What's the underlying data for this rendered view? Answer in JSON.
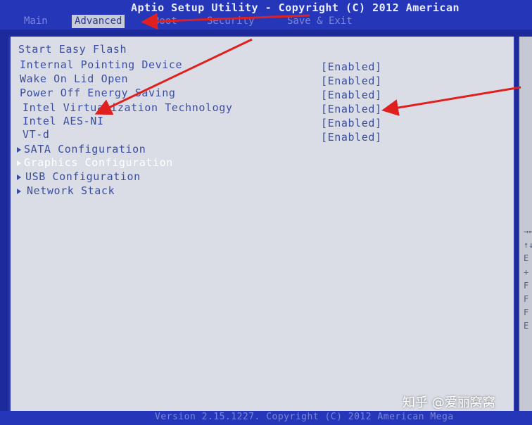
{
  "title": "Aptio Setup Utility - Copyright (C) 2012 American",
  "tabs": [
    {
      "label": "Main"
    },
    {
      "label": "Advanced"
    },
    {
      "label": "Boot"
    },
    {
      "label": "Security"
    },
    {
      "label": "Save & Exit"
    }
  ],
  "items": [
    {
      "label": "Start Easy Flash",
      "value": ""
    },
    {
      "label": "Internal Pointing Device",
      "value": "[Enabled]"
    },
    {
      "label": "Wake On Lid Open",
      "value": "[Enabled]"
    },
    {
      "label": "Power Off Energy Saving",
      "value": "[Enabled]"
    },
    {
      "label": "Intel Virtualization Technology",
      "value": "[Enabled]"
    },
    {
      "label": "Intel AES-NI",
      "value": "[Enabled]"
    },
    {
      "label": "VT-d",
      "value": "[Enabled]"
    }
  ],
  "submenus": [
    {
      "label": "SATA Configuration"
    },
    {
      "label": "Graphics Configuration",
      "selected": true
    },
    {
      "label": "USB Configuration"
    },
    {
      "label": "Network Stack"
    }
  ],
  "help_keys": [
    "→←",
    "↑↓",
    "E",
    "+",
    "F",
    "F",
    "F",
    "E"
  ],
  "footer": "Version 2.15.1227. Copyright (C) 2012 American Mega",
  "watermark": "知乎 @爱丽窝窝",
  "colors": {
    "background": "#1c2a9c",
    "panel": "#dadde6",
    "annotation_arrow": "#e0201e"
  }
}
